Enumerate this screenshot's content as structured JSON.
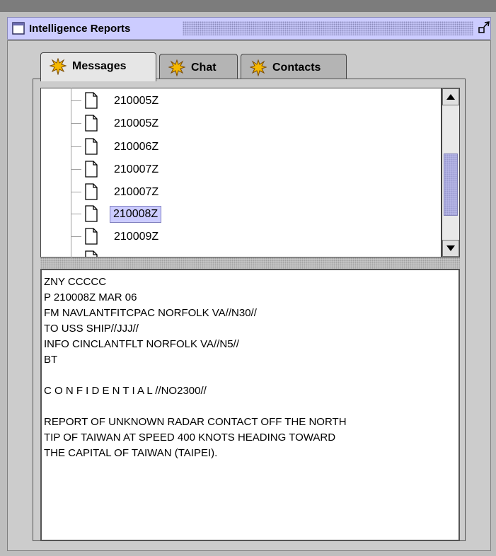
{
  "window": {
    "title": "Intelligence Reports",
    "icon": "window-icon",
    "restore_icon": "restore-icon"
  },
  "tabs": [
    {
      "label": "Messages",
      "icon": "star-burst-icon",
      "active": true
    },
    {
      "label": "Chat",
      "icon": "star-burst-icon",
      "active": false
    },
    {
      "label": "Contacts",
      "icon": "star-burst-icon",
      "active": false
    }
  ],
  "tree": {
    "items": [
      {
        "label": "210005Z"
      },
      {
        "label": "210005Z"
      },
      {
        "label": "210006Z"
      },
      {
        "label": "210007Z"
      },
      {
        "label": "210007Z"
      },
      {
        "label": "210008Z",
        "selected": true
      },
      {
        "label": "210009Z"
      }
    ]
  },
  "message": {
    "lines": [
      "ZNY CCCCC",
      "P 210008Z MAR 06",
      "FM NAVLANTFITCPAC NORFOLK VA//N30//",
      "TO USS SHIP//JJJ//",
      "INFO CINCLANTFLT NORFOLK VA//N5//",
      "BT",
      "",
      "C O N F I D E N T I A L //NO2300//",
      "",
      "REPORT OF UNKNOWN RADAR CONTACT OFF THE NORTH",
      "TIP OF TAIWAN AT SPEED 400 KNOTS HEADING TOWARD",
      "THE CAPITAL OF TAIWAN (TAIPEI)."
    ]
  },
  "colors": {
    "title_bar": "#ccccff",
    "selection": "#ccccff",
    "panel": "#cccccc",
    "scroll_thumb": "#b8b8e8"
  }
}
